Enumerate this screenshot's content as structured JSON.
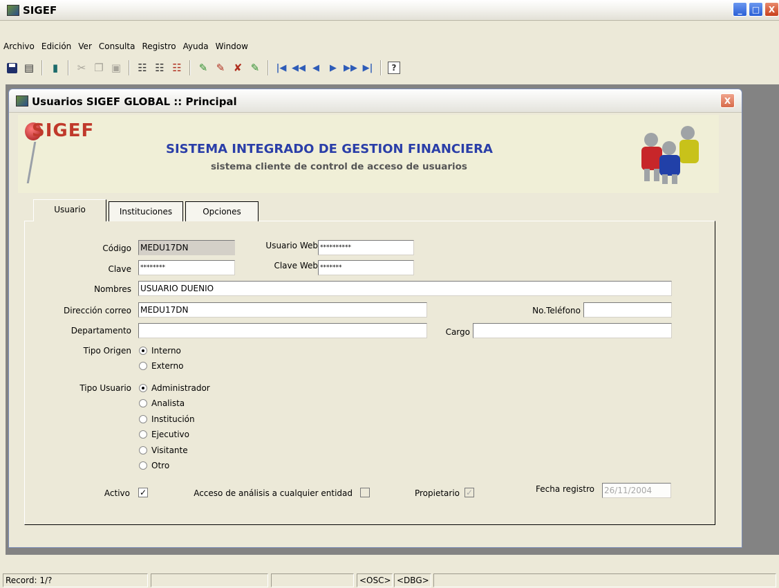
{
  "app": {
    "title": "SIGEF",
    "window_buttons": [
      "_",
      "□",
      "X"
    ]
  },
  "menu": [
    "Archivo",
    "Edición",
    "Ver",
    "Consulta",
    "Registro",
    "Ayuda",
    "Window"
  ],
  "toolbar": {
    "icons": [
      "save-icon",
      "print-icon",
      "exit-icon",
      "cut-icon",
      "copy-icon",
      "paste-icon",
      "query-icon",
      "query-execute-icon",
      "query-cancel-icon",
      "insert-record-icon",
      "delete-record-icon",
      "clear-record-icon",
      "duplicate-record-icon",
      "first-record-icon",
      "previous-block-icon",
      "previous-record-icon",
      "next-record-icon",
      "next-block-icon",
      "last-record-icon",
      "help-icon"
    ],
    "help_label": "?"
  },
  "child": {
    "title": "Usuarios SIGEF GLOBAL :: Principal",
    "close_label": "X"
  },
  "banner": {
    "logo": "SIGEF",
    "title": "SISTEMA INTEGRADO DE GESTION FINANCIERA",
    "subtitle": "sistema cliente de control de acceso de usuarios"
  },
  "tabs": [
    "Usuario",
    "Instituciones",
    "Opciones"
  ],
  "form": {
    "codigo": {
      "label": "Código",
      "value": "MEDU17DN"
    },
    "usuario_web": {
      "label": "Usuario Web",
      "value": "**********"
    },
    "clave": {
      "label": "Clave",
      "value": "********"
    },
    "clave_web": {
      "label": "Clave Web",
      "value": "*******"
    },
    "nombres": {
      "label": "Nombres",
      "value": "USUARIO DUENIO"
    },
    "direccion_correo": {
      "label": "Dirección correo",
      "value": "MEDU17DN"
    },
    "telefono": {
      "label": "No.Teléfono",
      "value": ""
    },
    "departamento": {
      "label": "Departamento",
      "value": ""
    },
    "cargo": {
      "label": "Cargo",
      "value": ""
    },
    "tipo_origen": {
      "label": "Tipo Origen",
      "options": [
        "Interno",
        "Externo"
      ],
      "selected": "Interno"
    },
    "tipo_usuario": {
      "label": "Tipo Usuario",
      "options": [
        "Administrador",
        "Analista",
        "Institución",
        "Ejecutivo",
        "Visitante",
        "Otro"
      ],
      "selected": "Administrador"
    },
    "activo": {
      "label": "Activo",
      "checked": true
    },
    "acceso_analisis": {
      "label": "Acceso de análisis  a cualquier entidad",
      "checked": false
    },
    "propietario": {
      "label": "Propietario",
      "checked": true
    },
    "fecha_registro": {
      "label": "Fecha registro",
      "value": "26/11/2004"
    }
  },
  "status": {
    "record": "Record: 1/?",
    "osc": "<OSC>",
    "dbg": "<DBG>"
  }
}
